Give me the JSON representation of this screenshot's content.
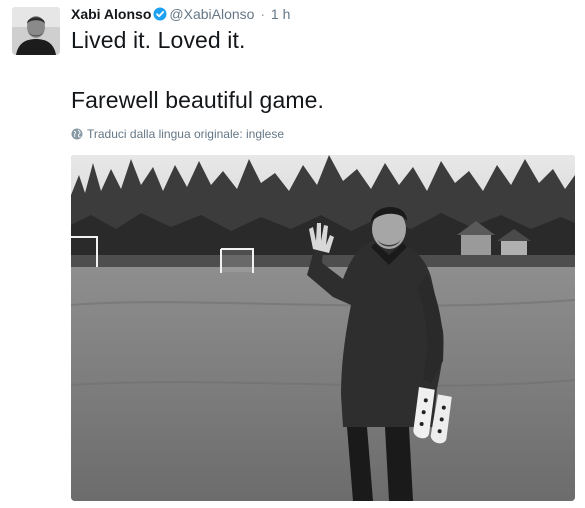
{
  "tweet": {
    "display_name": "Xabi Alonso",
    "handle": "@XabiAlonso",
    "separator": "·",
    "time": "1 h",
    "verified": true,
    "text_lines": [
      "Lived it. Loved it.",
      "",
      "Farewell beautiful game."
    ],
    "translate_label": "Traduci dalla lingua originale: inglese",
    "icons": {
      "avatar": "profile-photo",
      "verified": "verified-badge-icon",
      "translate": "globe-icon"
    },
    "colors": {
      "name": "#14171a",
      "meta": "#657786",
      "verified": "#1da1f2"
    }
  }
}
